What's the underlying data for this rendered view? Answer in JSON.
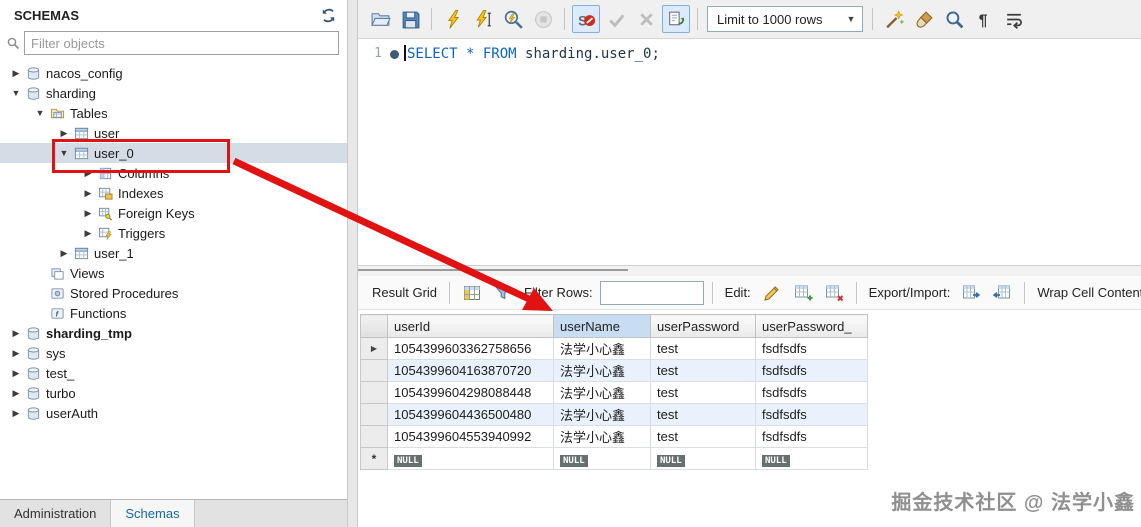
{
  "colors": {
    "annotation_red": "#e01212",
    "keyword_blue": "#0e62c8",
    "identifier_navy": "#263745",
    "null_badge_bg": "#66706f",
    "selection_bg": "#d4dce6",
    "active_tab_blue": "#1668ad",
    "header_highlight": "#c8dcf2"
  },
  "sidebar": {
    "title": "SCHEMAS",
    "filter_placeholder": "Filter objects",
    "tree": [
      {
        "label": "nacos_config",
        "level": 0,
        "icon": "schema",
        "has_children": true,
        "expanded": false
      },
      {
        "label": "sharding",
        "level": 0,
        "icon": "schema",
        "has_children": true,
        "expanded": true
      },
      {
        "label": "Tables",
        "level": 1,
        "icon": "tables-folder",
        "has_children": true,
        "expanded": true
      },
      {
        "label": "user",
        "level": 2,
        "icon": "table",
        "has_children": true,
        "expanded": false
      },
      {
        "label": "user_0",
        "level": 2,
        "icon": "table",
        "has_children": true,
        "expanded": true,
        "selected": true
      },
      {
        "label": "Columns",
        "level": 3,
        "icon": "columns",
        "has_children": true,
        "expanded": false
      },
      {
        "label": "Indexes",
        "level": 3,
        "icon": "indexes",
        "has_children": true,
        "expanded": false
      },
      {
        "label": "Foreign Keys",
        "level": 3,
        "icon": "foreign-keys",
        "has_children": true,
        "expanded": false
      },
      {
        "label": "Triggers",
        "level": 3,
        "icon": "triggers",
        "has_children": true,
        "expanded": false
      },
      {
        "label": "user_1",
        "level": 2,
        "icon": "table",
        "has_children": true,
        "expanded": false
      },
      {
        "label": "Views",
        "level": 1,
        "icon": "views",
        "has_children": false
      },
      {
        "label": "Stored Procedures",
        "level": 1,
        "icon": "procedures",
        "has_children": false
      },
      {
        "label": "Functions",
        "level": 1,
        "icon": "functions",
        "has_children": false
      },
      {
        "label": "sharding_tmp",
        "level": 0,
        "icon": "schema",
        "has_children": true,
        "expanded": false,
        "bold": true
      },
      {
        "label": "sys",
        "level": 0,
        "icon": "schema",
        "has_children": true,
        "expanded": false
      },
      {
        "label": "test_",
        "level": 0,
        "icon": "schema",
        "has_children": true,
        "expanded": false
      },
      {
        "label": "turbo",
        "level": 0,
        "icon": "schema",
        "has_children": true,
        "expanded": false
      },
      {
        "label": "userAuth",
        "level": 0,
        "icon": "schema",
        "has_children": true,
        "expanded": false
      }
    ],
    "tabs": [
      {
        "label": "Administration",
        "active": false
      },
      {
        "label": "Schemas",
        "active": true
      }
    ]
  },
  "editor_toolbar": {
    "items": [
      {
        "type": "icon",
        "name": "open-file",
        "enabled": true
      },
      {
        "type": "icon",
        "name": "save",
        "enabled": true
      },
      {
        "type": "sep"
      },
      {
        "type": "icon",
        "name": "execute",
        "enabled": true
      },
      {
        "type": "icon",
        "name": "execute-current",
        "enabled": true
      },
      {
        "type": "icon",
        "name": "explain",
        "enabled": true
      },
      {
        "type": "icon",
        "name": "stop",
        "enabled": false
      },
      {
        "type": "sep"
      },
      {
        "type": "icon",
        "name": "toggle-stop-on-error",
        "enabled": true,
        "active": true
      },
      {
        "type": "icon",
        "name": "commit",
        "enabled": false
      },
      {
        "type": "icon",
        "name": "rollback",
        "enabled": false
      },
      {
        "type": "icon",
        "name": "toggle-autocommit",
        "enabled": true,
        "active": true
      },
      {
        "type": "sep"
      },
      {
        "type": "dropdown",
        "name": "limit-rows",
        "label": "Limit to 1000 rows"
      },
      {
        "type": "sep"
      },
      {
        "type": "icon",
        "name": "beautify",
        "enabled": true
      },
      {
        "type": "icon",
        "name": "clean",
        "enabled": true
      },
      {
        "type": "icon",
        "name": "find",
        "enabled": true
      },
      {
        "type": "icon",
        "name": "show-invisibles",
        "enabled": true
      },
      {
        "type": "icon",
        "name": "wrap-text",
        "enabled": true
      }
    ]
  },
  "editor": {
    "line_number": "1",
    "sql_tokens": [
      {
        "text": "SELECT",
        "type": "keyword"
      },
      {
        "text": " * ",
        "type": "keyword"
      },
      {
        "text": "FROM",
        "type": "keyword"
      },
      {
        "text": " sharding.user_0;",
        "type": "identifier"
      }
    ]
  },
  "results": {
    "toolbar": {
      "grid_label": "Result Grid",
      "filter_label": "Filter Rows:",
      "filter_value": "",
      "edit_label": "Edit:",
      "export_label": "Export/Import:",
      "wrap_label": "Wrap Cell Content:"
    },
    "columns": [
      "userId",
      "userName",
      "userPassword",
      "userPassword_"
    ],
    "highlighted_column": "userName",
    "rows": [
      [
        "1054399603362758656",
        "法学小心鑫",
        "test",
        "fsdfsdfs"
      ],
      [
        "1054399604163870720",
        "法学小心鑫",
        "test",
        "fsdfsdfs"
      ],
      [
        "1054399604298088448",
        "法学小心鑫",
        "test",
        "fsdfsdfs"
      ],
      [
        "1054399604436500480",
        "法学小心鑫",
        "test",
        "fsdfsdfs"
      ],
      [
        "1054399604553940992",
        "法学小心鑫",
        "test",
        "fsdfsdfs"
      ]
    ],
    "current_row_marker": "▶",
    "append_row_marker": "*",
    "null_placeholder": "NULL"
  },
  "watermark": "掘金技术社区 @ 法学小鑫"
}
